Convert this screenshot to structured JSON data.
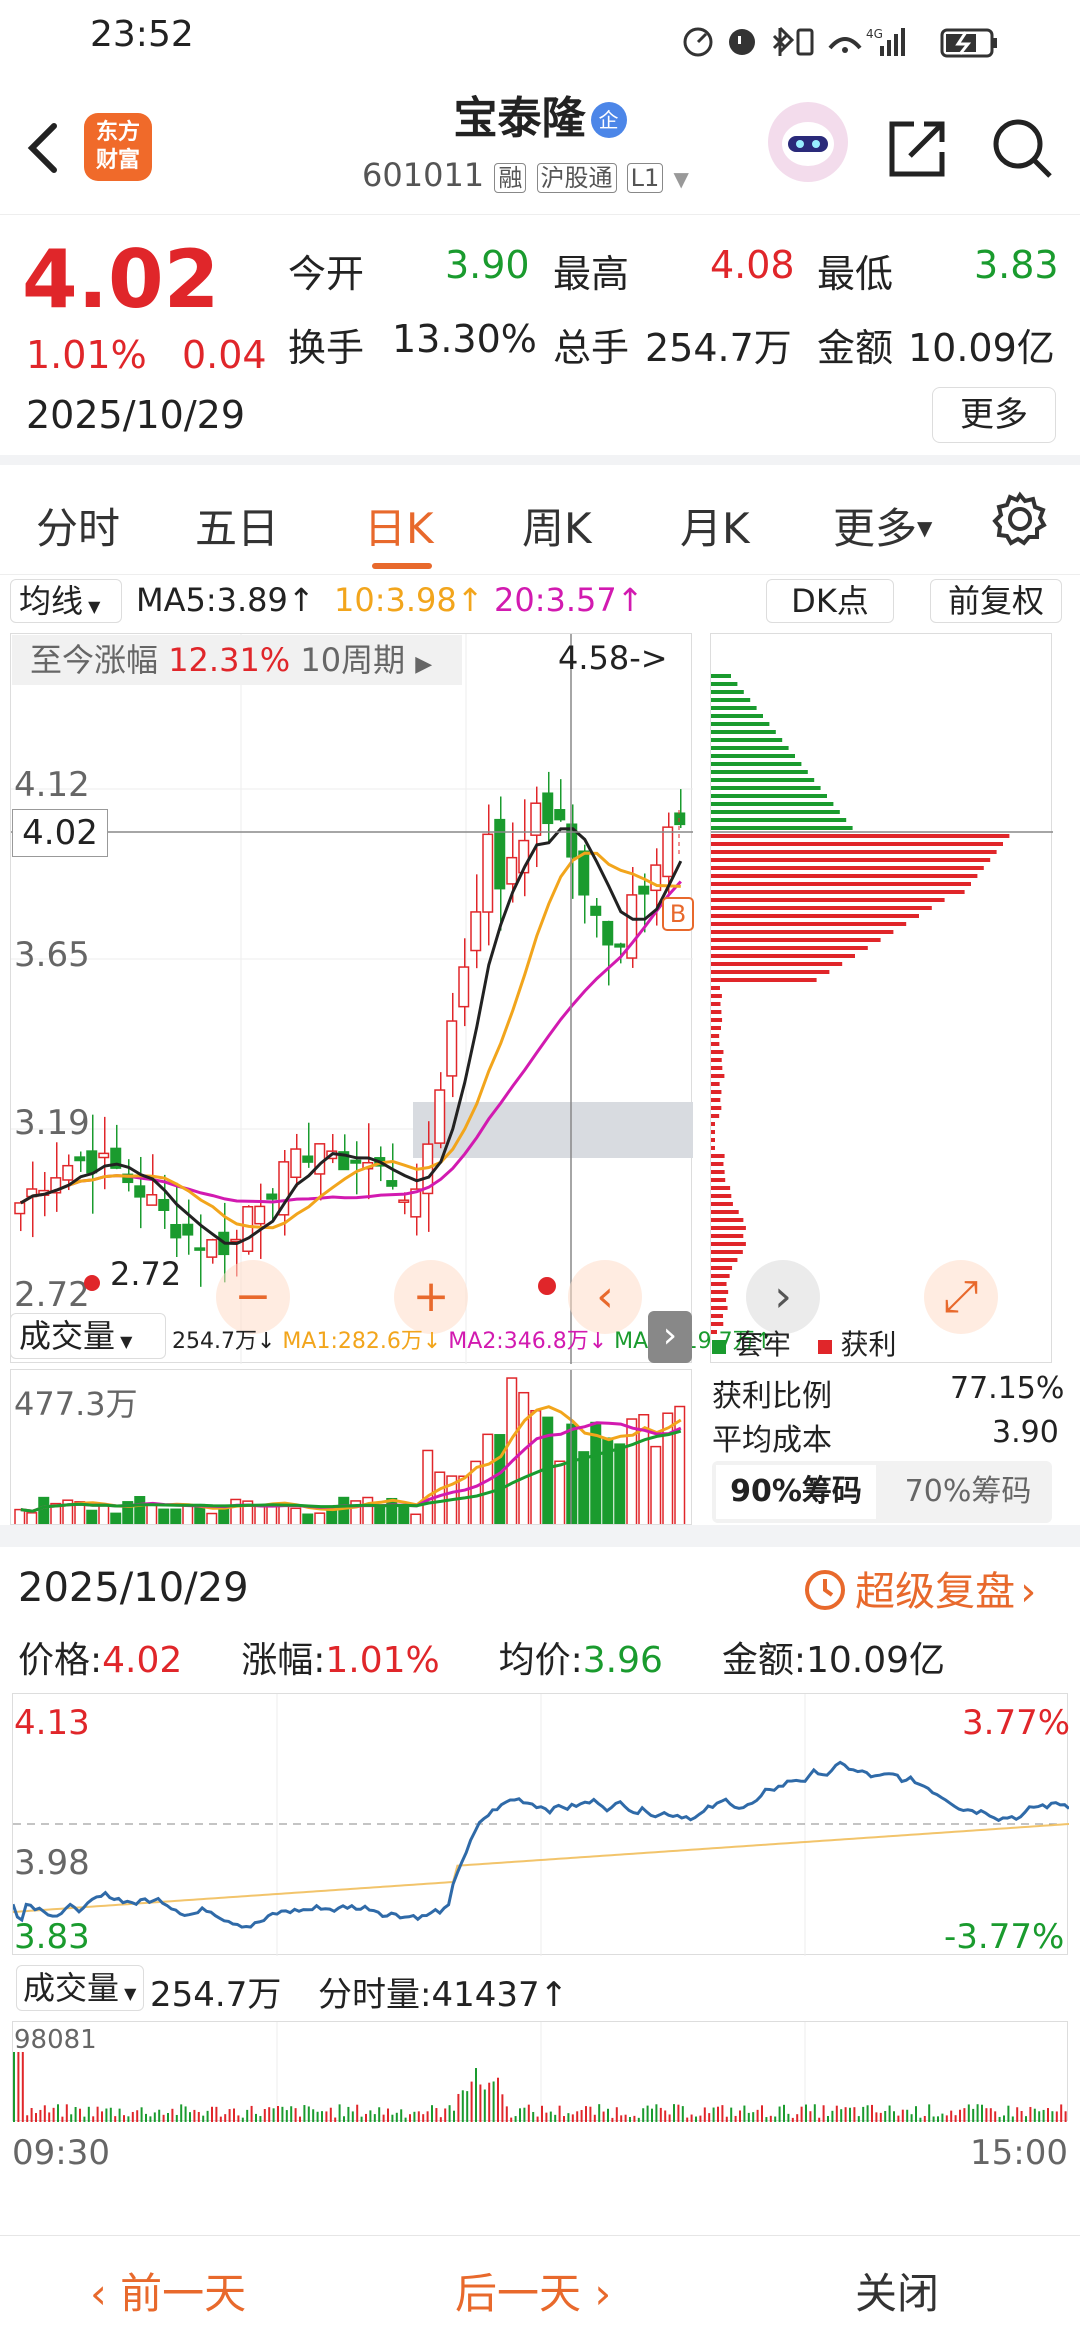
{
  "status_bar": {
    "time": "23:52"
  },
  "header": {
    "title": "宝泰隆",
    "badge": "企",
    "code": "601011",
    "tags": [
      "融",
      "沪股通",
      "L1"
    ],
    "logo_line1": "东方",
    "logo_line2": "财富"
  },
  "quote": {
    "price": "4.02",
    "change_pct": "1.01%",
    "change_abs": "0.04",
    "date": "2025/10/29",
    "open_label": "今开",
    "open": "3.90",
    "high_label": "最高",
    "high": "4.08",
    "low_label": "最低",
    "low": "3.83",
    "turnover_label": "换手",
    "turnover": "13.30%",
    "volume_label": "总手",
    "volume": "254.7万",
    "amount_label": "金额",
    "amount": "10.09亿",
    "more_button": "更多"
  },
  "tabs": [
    {
      "label": "分时"
    },
    {
      "label": "五日"
    },
    {
      "label": "日K"
    },
    {
      "label": "周K"
    },
    {
      "label": "月K"
    },
    {
      "label": "更多"
    }
  ],
  "kline": {
    "ma_selector": "均线",
    "ma5": "MA5:3.89↑",
    "ma10": "10:3.98↑",
    "ma20": "20:3.57↑",
    "dk_button": "DK点",
    "adjust_button": "前复权",
    "range_label": "至今涨幅",
    "range_value": "12.31%",
    "range_period": "10周期",
    "max_label": "4.58->",
    "min_label": "2.72",
    "current_price_tag": "4.02",
    "axis": [
      "4.12",
      "3.65",
      "3.19",
      "2.72"
    ],
    "b_marker": "B",
    "volume_selector": "成交量",
    "vol_value": "254.7万↓",
    "vol_ma1": "MA1:282.6万↓",
    "vol_ma2": "MA2:346.8万↓",
    "vol_ma3": "MA3:219.7万↑",
    "vol_axis_max": "477.3万",
    "colors": {
      "ma5": "#222222",
      "ma10": "#f2a51c",
      "ma20": "#d21ab0",
      "up": "#e0262a",
      "down": "#1a9b2e"
    }
  },
  "chips": {
    "legend_loss": "套牢",
    "legend_profit": "获利",
    "profit_ratio_label": "获利比例",
    "profit_ratio": "77.15%",
    "avg_cost_label": "平均成本",
    "avg_cost": "3.90",
    "tab90": "90%筹码",
    "tab70": "70%筹码"
  },
  "intraday": {
    "date": "2025/10/29",
    "replay": "超级复盘",
    "price_label": "价格:",
    "price": "4.02",
    "pct_label": "涨幅:",
    "pct": "1.01%",
    "avg_label": "均价:",
    "avg": "3.96",
    "amount_label": "金额:",
    "amount": "10.09亿",
    "y_top": "4.13",
    "y_mid": "3.98",
    "y_bot": "3.83",
    "pct_top": "3.77%",
    "pct_bot": "-3.77%",
    "vol_selector": "成交量",
    "vol_total": "254.7万",
    "vol_minute": "分时量:41437↑",
    "vol_axis": "98081",
    "t_start": "09:30",
    "t_end": "15:00"
  },
  "footer": {
    "prev": "前一天",
    "next": "后一天",
    "close": "关闭"
  }
}
